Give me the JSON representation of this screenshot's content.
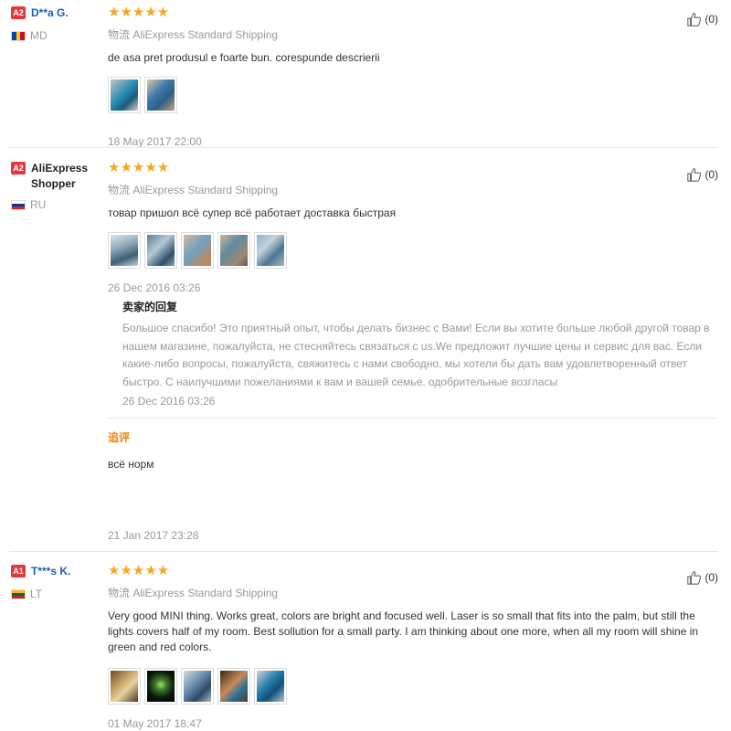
{
  "reviews": [
    {
      "level": "A2",
      "user": "D**a G.",
      "country": "MD",
      "stars": "★★★★★",
      "shipping": "物流 AliExpress Standard Shipping",
      "text": "de asa pret produsul e foarte bun. corespunde descrierii",
      "photos": 2,
      "date": "18 May 2017 22:00",
      "likes": "(0)"
    },
    {
      "level": "A2",
      "user": "AliExpress Shopper",
      "country": "RU",
      "stars": "★★★★★",
      "shipping": "物流 AliExpress Standard Shipping",
      "text": "товар пришол всё супер всё работает доставка быстрая",
      "photos": 5,
      "date": "26 Dec 2016 03:26",
      "likes": "(0)",
      "seller_reply": {
        "title": "卖家的回复",
        "text": "Большое спасибо! Это приятный опыт, чтобы делать бизнес с Вами! Если вы хотите больше любой другой товар в нашем магазине, пожалуйста, не стесняйтесь связаться с us.We предложит лучшие цены и сервис для вас. Если какие-либо вопросы, пожалуйста, свяжитесь с нами свободно, мы хотели бы дать вам удовлетворенный ответ быстро. С наилучшими пожеланиями к вам и вашей семье. одобрительные возгласы",
        "date": "26 Dec 2016 03:26"
      },
      "additional": {
        "title": "追评",
        "text": "всё норм",
        "date": "21 Jan 2017 23:28"
      }
    },
    {
      "level": "A1",
      "user": "T***s K.",
      "country": "LT",
      "stars": "★★★★★",
      "shipping": "物流 AliExpress Standard Shipping",
      "text": "Very good MINI thing. Works great, colors are bright and focused well. Laser is so small that fits into the palm, but still the lights covers half of my room. Best sollution for a small party. I am thinking about one more, when all my room will shine in green and red colors.",
      "photos": 5,
      "date": "01 May 2017 18:47",
      "likes": "(0)"
    }
  ],
  "colors": {
    "username": "#1a5fb4",
    "star": "#f5a623",
    "level_badge": "#e4393c",
    "additional_title": "#f08200"
  }
}
